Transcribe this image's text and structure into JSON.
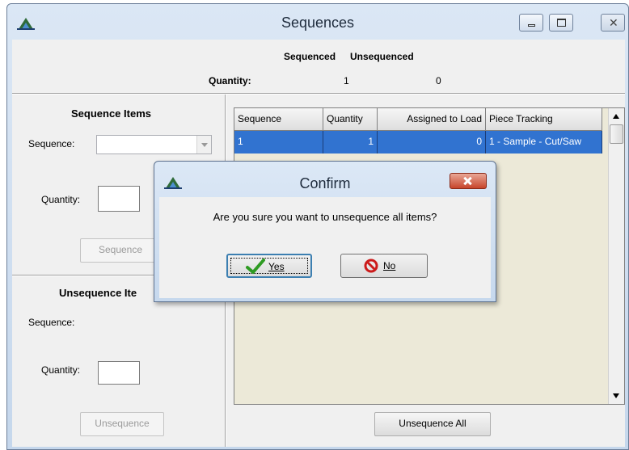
{
  "window": {
    "title": "Sequences",
    "caption_buttons": [
      "minimize-icon",
      "maximize-icon",
      "close-icon"
    ]
  },
  "summary": {
    "col_sequenced": "Sequenced",
    "col_unsequenced": "Unsequenced",
    "quantity_label": "Quantity:",
    "sequenced_value": "1",
    "unsequenced_value": "0"
  },
  "sequence_items": {
    "title": "Sequence Items",
    "sequence_label": "Sequence:",
    "sequence_value": "",
    "quantity_label": "Quantity:",
    "quantity_value": "",
    "button_label": "Sequence"
  },
  "unsequence_items": {
    "title": "Unsequence Ite",
    "sequence_label": "Sequence:",
    "quantity_label": "Quantity:",
    "quantity_value": "",
    "button_label": "Unsequence"
  },
  "grid": {
    "columns": [
      "Sequence",
      "Quantity",
      "Assigned to Load",
      "Piece Tracking"
    ],
    "rows": [
      {
        "sequence": "1",
        "quantity": "1",
        "assigned_to_load": "0",
        "piece_tracking": "1 - Sample - Cut/Saw"
      }
    ]
  },
  "unsequence_all_label": "Unsequence All",
  "dialog": {
    "title": "Confirm",
    "message": "Are you sure you want to unsequence all items?",
    "yes_label": "Yes",
    "no_label": "No"
  },
  "colors": {
    "selection": "#3173d0",
    "dialog_close": "#c7452b",
    "yes_check": "#2e9b22",
    "no_icon": "#cc1a1a"
  }
}
